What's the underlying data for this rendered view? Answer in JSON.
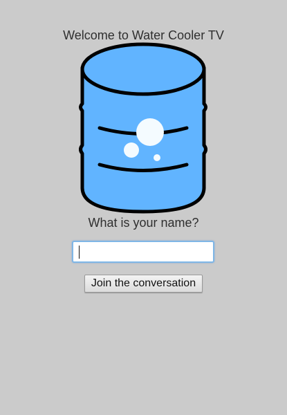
{
  "app": {
    "welcome_text": "Welcome to Water Cooler TV",
    "logo_icon": "water-cooler-bottle-icon"
  },
  "form": {
    "question": "What is your name?",
    "name_value": "",
    "name_placeholder": "",
    "join_label": "Join the conversation"
  },
  "colors": {
    "background": "#cbcbcb",
    "bottle_fill": "#61b4ff",
    "bottle_outline": "#000000",
    "bubbles": "#f4fbff",
    "input_focus_border": "#7fb6e6"
  }
}
